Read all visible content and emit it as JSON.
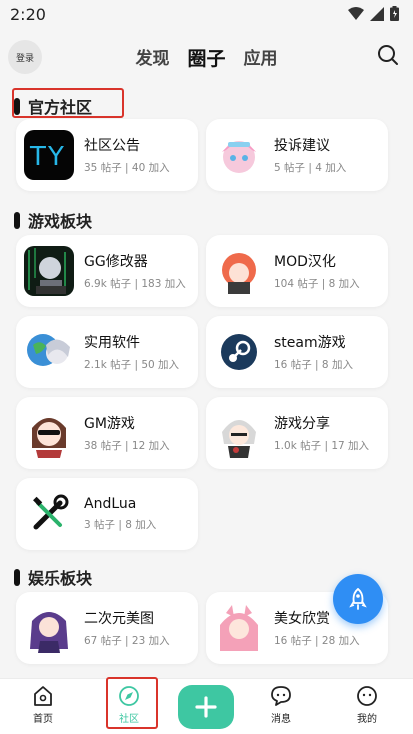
{
  "status_bar": {
    "time": "2:20"
  },
  "header": {
    "login_label": "登录",
    "tabs": [
      {
        "label": "发现"
      },
      {
        "label": "圈子"
      },
      {
        "label": "应用"
      }
    ]
  },
  "sections": [
    {
      "title": "官方社区",
      "cards": [
        {
          "title": "社区公告",
          "posts": "35 帖子",
          "joined": "40 加入",
          "icon": "ty-logo-icon"
        },
        {
          "title": "投诉建议",
          "posts": "5 帖子",
          "joined": "4 加入",
          "icon": "anime-girl-avatar-icon"
        }
      ]
    },
    {
      "title": "游戏板块",
      "cards": [
        {
          "title": "GG修改器",
          "posts": "6.9k 帖子",
          "joined": "183 加入",
          "icon": "hacker-avatar-icon"
        },
        {
          "title": "MOD汉化",
          "posts": "104 帖子",
          "joined": "8 加入",
          "icon": "anime-girl-avatar-icon"
        },
        {
          "title": "实用软件",
          "posts": "2.1k 帖子",
          "joined": "50 加入",
          "icon": "earth-girl-avatar-icon"
        },
        {
          "title": "steam游戏",
          "posts": "16 帖子",
          "joined": "8 加入",
          "icon": "steam-logo-icon"
        },
        {
          "title": "GM游戏",
          "posts": "38 帖子",
          "joined": "12 加入",
          "icon": "maid-avatar-icon"
        },
        {
          "title": "游戏分享",
          "posts": "1.0k 帖子",
          "joined": "17 加入",
          "icon": "chibi-avatar-icon"
        },
        {
          "title": "AndLua",
          "posts": "3 帖子",
          "joined": "8 加入",
          "icon": "tools-icon"
        }
      ]
    },
    {
      "title": "娱乐板块",
      "cards": [
        {
          "title": "二次元美图",
          "posts": "67 帖子",
          "joined": "23 加入",
          "icon": "purple-hair-avatar-icon"
        },
        {
          "title": "美女欣赏",
          "posts": "16 帖子",
          "joined": "28 加入",
          "icon": "pink-hair-avatar-icon"
        }
      ]
    }
  ],
  "bottom_nav": [
    {
      "label": "首页",
      "icon": "home-icon"
    },
    {
      "label": "社区",
      "icon": "compass-icon"
    },
    {
      "label": "消息",
      "icon": "chat-icon"
    },
    {
      "label": "我的",
      "icon": "profile-icon"
    }
  ],
  "colors": {
    "accent": "#3ec7a2",
    "fab": "#2f8ef4",
    "highlight": "#d9342b"
  }
}
